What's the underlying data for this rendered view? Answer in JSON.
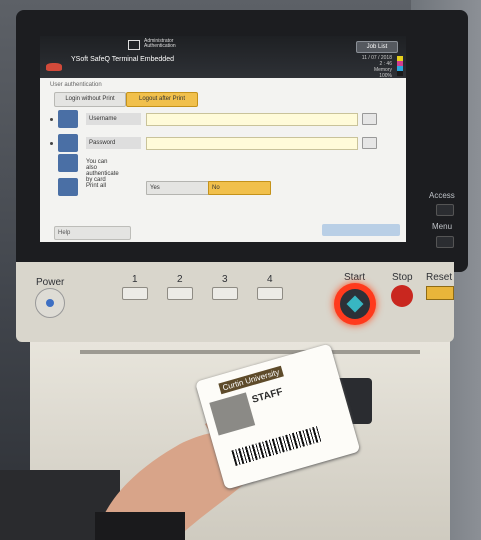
{
  "screen_header": {
    "admin_text": "Administrator Authentication",
    "job_list": "Job List",
    "app_title": "YSoft SafeQ Terminal Embedded",
    "status_lines": [
      "11 / 07 / 2018",
      "2 : 46",
      "Memory",
      "100%"
    ],
    "ink_colors": [
      "#e6cf1c",
      "#d13e8f",
      "#2da6dd",
      "#1a1a1a"
    ]
  },
  "auth": {
    "section_title": "User authentication",
    "tab_login_without_print": "Login without Print",
    "tab_logout_after_print": "Logout after Print",
    "username_label": "Username",
    "password_label": "Password",
    "card_text": "You can also authenticate by card",
    "print_all_label": "Print all",
    "yes_label": "Yes",
    "no_label": "No",
    "help_label": "Help"
  },
  "side": {
    "access_label": "Access",
    "menu_label": "Menu"
  },
  "panel": {
    "power_label": "Power",
    "num1": "1",
    "num2": "2",
    "num3": "3",
    "num4": "4",
    "start_label": "Start",
    "stop_label": "Stop",
    "reset_label": "Reset"
  },
  "card": {
    "university": "Curtin University",
    "staff": "STAFF"
  }
}
